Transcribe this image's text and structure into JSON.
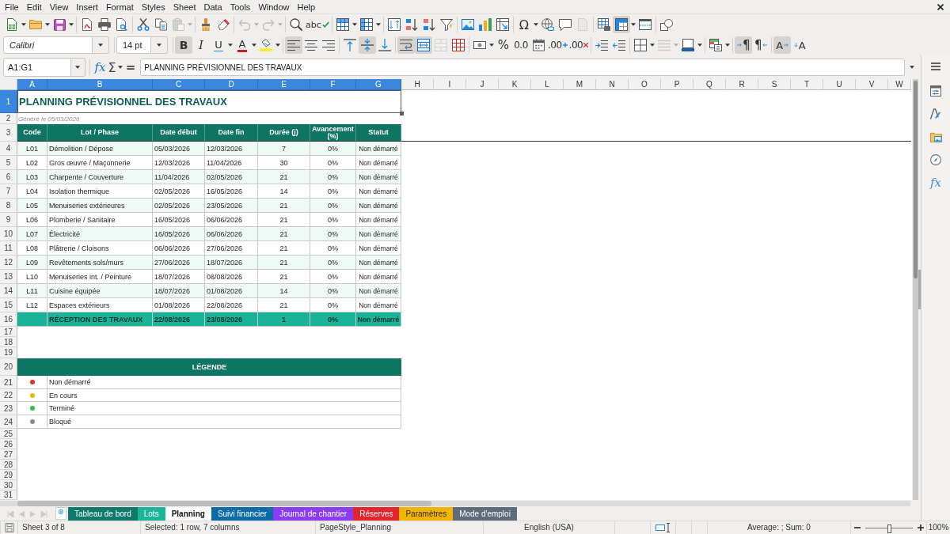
{
  "menu": [
    "File",
    "Edit",
    "View",
    "Insert",
    "Format",
    "Styles",
    "Sheet",
    "Data",
    "Tools",
    "Window",
    "Help"
  ],
  "standard_toolbar": [
    [
      {
        "kind": "new",
        "dropdown": true,
        "on": false,
        "disabled": false
      },
      {
        "kind": "open",
        "dropdown": true,
        "on": false,
        "disabled": false
      },
      {
        "kind": "save",
        "dropdown": true,
        "on": false,
        "disabled": false
      }
    ],
    [
      {
        "kind": "export_pdf",
        "dropdown": false,
        "on": false,
        "disabled": false
      },
      {
        "kind": "print",
        "dropdown": false,
        "on": false,
        "disabled": false
      },
      {
        "kind": "print_preview",
        "dropdown": false,
        "on": false,
        "disabled": false
      }
    ],
    [
      {
        "kind": "cut",
        "dropdown": false,
        "on": false,
        "disabled": false
      },
      {
        "kind": "copy",
        "dropdown": false,
        "on": false,
        "disabled": false
      },
      {
        "kind": "paste",
        "dropdown": true,
        "on": false,
        "disabled": true
      }
    ],
    [
      {
        "kind": "clone_formatting",
        "dropdown": false,
        "on": false,
        "disabled": false
      },
      {
        "kind": "clear_formatting",
        "dropdown": false,
        "on": false,
        "disabled": false
      }
    ],
    [
      {
        "kind": "undo",
        "dropdown": true,
        "on": false,
        "disabled": true
      },
      {
        "kind": "redo",
        "dropdown": true,
        "on": false,
        "disabled": true
      }
    ],
    [
      {
        "kind": "find_replace",
        "dropdown": false,
        "on": false,
        "disabled": false
      },
      {
        "kind": "spelling",
        "label": "abc",
        "dropdown": false,
        "on": false,
        "disabled": false
      }
    ],
    [
      {
        "kind": "row",
        "dropdown": true,
        "on": false,
        "disabled": false
      },
      {
        "kind": "column",
        "dropdown": true,
        "on": false,
        "disabled": false
      }
    ],
    [
      {
        "kind": "sort",
        "dropdown": false,
        "on": false,
        "disabled": false
      },
      {
        "kind": "sort_ascending",
        "dropdown": false,
        "on": false,
        "disabled": false
      },
      {
        "kind": "sort_descending",
        "dropdown": false,
        "on": false,
        "disabled": false
      },
      {
        "kind": "autofilter",
        "dropdown": false,
        "on": false,
        "disabled": false
      }
    ],
    [
      {
        "kind": "image",
        "dropdown": false,
        "on": false,
        "disabled": false
      },
      {
        "kind": "chart",
        "dropdown": false,
        "on": false,
        "disabled": false
      },
      {
        "kind": "pivot_table",
        "dropdown": false,
        "on": false,
        "disabled": false
      }
    ],
    [
      {
        "kind": "special_character",
        "label": "Ω",
        "dropdown": true,
        "on": false,
        "disabled": false
      },
      {
        "kind": "hyperlink",
        "dropdown": false,
        "on": false,
        "disabled": false
      },
      {
        "kind": "comment",
        "dropdown": false,
        "on": false,
        "disabled": false
      },
      {
        "kind": "header_footer",
        "dropdown": false,
        "on": false,
        "disabled": true
      }
    ],
    [
      {
        "kind": "print_area",
        "dropdown": false,
        "on": false,
        "disabled": false
      },
      {
        "kind": "freeze",
        "dropdown": true,
        "on": true,
        "disabled": false
      },
      {
        "kind": "split_window",
        "dropdown": false,
        "on": false,
        "disabled": false
      }
    ],
    [
      {
        "kind": "shapes",
        "dropdown": false,
        "on": false,
        "disabled": false
      }
    ]
  ],
  "formatting_toolbar": [
    [
      {
        "kind": "font_name",
        "value": "Calibri",
        "dropdown": true
      }
    ],
    [
      {
        "kind": "font_size",
        "value": "14 pt",
        "dropdown": true
      }
    ],
    [
      {
        "kind": "bold",
        "label": "B",
        "dropdown": false,
        "on": true,
        "disabled": false
      },
      {
        "kind": "italic",
        "label": "I",
        "dropdown": false,
        "on": false,
        "disabled": false
      },
      {
        "kind": "underline",
        "label": "U",
        "dropdown": true,
        "on": false,
        "disabled": false
      },
      {
        "kind": "font_color",
        "label": "A",
        "dropdown": true,
        "on": false,
        "disabled": false
      },
      {
        "kind": "highlight",
        "dropdown": true,
        "on": false,
        "disabled": false
      }
    ],
    [
      {
        "kind": "align_left",
        "dropdown": false,
        "on": true,
        "disabled": false
      },
      {
        "kind": "align_center",
        "dropdown": false,
        "on": false,
        "disabled": false
      },
      {
        "kind": "align_right",
        "dropdown": false,
        "on": false,
        "disabled": false
      }
    ],
    [
      {
        "kind": "align_top",
        "dropdown": false,
        "on": false,
        "disabled": false
      },
      {
        "kind": "align_middle",
        "dropdown": false,
        "on": true,
        "disabled": false
      },
      {
        "kind": "align_bottom",
        "dropdown": false,
        "on": false,
        "disabled": false
      }
    ],
    [
      {
        "kind": "wrap_text",
        "dropdown": false,
        "on": true,
        "disabled": false
      },
      {
        "kind": "merge_center",
        "dropdown": false,
        "on": true,
        "disabled": false
      },
      {
        "kind": "merge_cells",
        "dropdown": false,
        "on": false,
        "disabled": true
      },
      {
        "kind": "unmerge_cells",
        "dropdown": false,
        "on": false,
        "disabled": false
      }
    ],
    [
      {
        "kind": "number_format",
        "dropdown": true,
        "on": false,
        "disabled": false
      },
      {
        "kind": "percent",
        "label": "%",
        "dropdown": false,
        "on": false,
        "disabled": false
      },
      {
        "kind": "number",
        "label": "0.0",
        "dropdown": false,
        "on": false,
        "disabled": false
      },
      {
        "kind": "date",
        "dropdown": false,
        "on": false,
        "disabled": false
      },
      {
        "kind": "add_decimal",
        "label": ".00",
        "dropdown": false,
        "on": false,
        "disabled": false
      },
      {
        "kind": "delete_decimal",
        "label": ".00",
        "dropdown": false,
        "on": false,
        "disabled": false
      }
    ],
    [
      {
        "kind": "indent",
        "dropdown": false,
        "on": false,
        "disabled": false
      },
      {
        "kind": "outdent",
        "dropdown": false,
        "on": false,
        "disabled": false
      }
    ],
    [
      {
        "kind": "borders",
        "dropdown": true,
        "on": false,
        "disabled": false
      },
      {
        "kind": "border_style",
        "dropdown": true,
        "on": false,
        "disabled": true
      },
      {
        "kind": "border_color",
        "dropdown": true,
        "on": false,
        "disabled": false
      }
    ],
    [
      {
        "kind": "conditional",
        "dropdown": true,
        "on": false,
        "disabled": false
      }
    ],
    [
      {
        "kind": "left_to_right",
        "label": "¶",
        "dropdown": false,
        "on": true,
        "disabled": false
      },
      {
        "kind": "right_to_left",
        "label": "¶",
        "dropdown": false,
        "on": false,
        "disabled": false
      }
    ],
    [
      {
        "kind": "text_left_to_right",
        "label": "A",
        "dropdown": false,
        "on": true,
        "disabled": false
      },
      {
        "kind": "text_top_to_bottom",
        "label": "A",
        "dropdown": false,
        "on": false,
        "disabled": false
      }
    ]
  ],
  "formula_bar": {
    "name_box": "A1:G1",
    "function_wizard": "fx",
    "sum": "Σ",
    "equals": "=",
    "formula": "PLANNING PRÉVISIONNEL DES TRAVAUX"
  },
  "sheet": {
    "columns": [
      {
        "label": "A",
        "selected": true
      },
      {
        "label": "B",
        "selected": true
      },
      {
        "label": "C",
        "selected": true
      },
      {
        "label": "D",
        "selected": true
      },
      {
        "label": "E",
        "selected": true
      },
      {
        "label": "F",
        "selected": true
      },
      {
        "label": "G",
        "selected": true
      },
      {
        "label": "H",
        "selected": false
      },
      {
        "label": "I",
        "selected": false
      },
      {
        "label": "J",
        "selected": false
      },
      {
        "label": "K",
        "selected": false
      },
      {
        "label": "L",
        "selected": false
      },
      {
        "label": "M",
        "selected": false
      },
      {
        "label": "N",
        "selected": false
      },
      {
        "label": "O",
        "selected": false
      },
      {
        "label": "P",
        "selected": false
      },
      {
        "label": "Q",
        "selected": false
      },
      {
        "label": "R",
        "selected": false
      },
      {
        "label": "S",
        "selected": false
      },
      {
        "label": "T",
        "selected": false
      },
      {
        "label": "U",
        "selected": false
      },
      {
        "label": "V",
        "selected": false
      },
      {
        "label": "W",
        "selected": false
      }
    ],
    "rows": [
      {
        "label": "1",
        "selected": true
      },
      {
        "label": "2",
        "selected": false
      },
      {
        "label": "3",
        "selected": false
      },
      {
        "label": "4",
        "selected": false
      },
      {
        "label": "5",
        "selected": false
      },
      {
        "label": "6",
        "selected": false
      },
      {
        "label": "7",
        "selected": false
      },
      {
        "label": "8",
        "selected": false
      },
      {
        "label": "9",
        "selected": false
      },
      {
        "label": "10",
        "selected": false
      },
      {
        "label": "11",
        "selected": false
      },
      {
        "label": "12",
        "selected": false
      },
      {
        "label": "13",
        "selected": false
      },
      {
        "label": "14",
        "selected": false
      },
      {
        "label": "15",
        "selected": false
      },
      {
        "label": "16",
        "selected": false
      },
      {
        "label": "17",
        "selected": false
      },
      {
        "label": "18",
        "selected": false
      },
      {
        "label": "19",
        "selected": false
      },
      {
        "label": "20",
        "selected": false
      },
      {
        "label": "21",
        "selected": false
      },
      {
        "label": "22",
        "selected": false
      },
      {
        "label": "23",
        "selected": false
      },
      {
        "label": "24",
        "selected": false
      },
      {
        "label": "25",
        "selected": false
      },
      {
        "label": "26",
        "selected": false
      },
      {
        "label": "27",
        "selected": false
      },
      {
        "label": "28",
        "selected": false
      },
      {
        "label": "29",
        "selected": false
      },
      {
        "label": "30",
        "selected": false
      },
      {
        "label": "31",
        "selected": false
      }
    ],
    "title": "PLANNING PRÉVISIONNEL DES TRAVAUX",
    "subtitle": "Généré le 05/03/2026",
    "table": {
      "columns": [
        "Code",
        "Lot / Phase",
        "Date début",
        "Date fin",
        "Durée (j)",
        "Avancement (%)",
        "Statut"
      ],
      "rows": [
        {
          "kind": "task",
          "code": "L01",
          "lot": "Démolition / Dépose",
          "start": "05/03/2026",
          "end": "12/03/2026",
          "duration": "7",
          "progress": "0%",
          "status": "Non démarré"
        },
        {
          "kind": "task",
          "code": "L02",
          "lot": "Gros œuvre / Maçonnerie",
          "start": "12/03/2026",
          "end": "11/04/2026",
          "duration": "30",
          "progress": "0%",
          "status": "Non démarré"
        },
        {
          "kind": "task",
          "code": "L03",
          "lot": "Charpente / Couverture",
          "start": "11/04/2026",
          "end": "02/05/2026",
          "duration": "21",
          "progress": "0%",
          "status": "Non démarré"
        },
        {
          "kind": "task",
          "code": "L04",
          "lot": "Isolation thermique",
          "start": "02/05/2026",
          "end": "16/05/2026",
          "duration": "14",
          "progress": "0%",
          "status": "Non démarré"
        },
        {
          "kind": "task",
          "code": "L05",
          "lot": "Menuiseries extérieures",
          "start": "02/05/2026",
          "end": "23/05/2026",
          "duration": "21",
          "progress": "0%",
          "status": "Non démarré"
        },
        {
          "kind": "task",
          "code": "L06",
          "lot": "Plomberie / Sanitaire",
          "start": "16/05/2026",
          "end": "06/06/2026",
          "duration": "21",
          "progress": "0%",
          "status": "Non démarré"
        },
        {
          "kind": "task",
          "code": "L07",
          "lot": "Électricité",
          "start": "16/05/2026",
          "end": "06/06/2026",
          "duration": "21",
          "progress": "0%",
          "status": "Non démarré"
        },
        {
          "kind": "task",
          "code": "L08",
          "lot": "Plâtrerie / Cloisons",
          "start": "06/06/2026",
          "end": "27/06/2026",
          "duration": "21",
          "progress": "0%",
          "status": "Non démarré"
        },
        {
          "kind": "task",
          "code": "L09",
          "lot": "Revêtements sols/murs",
          "start": "27/06/2026",
          "end": "18/07/2026",
          "duration": "21",
          "progress": "0%",
          "status": "Non démarré"
        },
        {
          "kind": "task",
          "code": "L10",
          "lot": "Menuiseries int. / Peinture",
          "start": "18/07/2026",
          "end": "08/08/2026",
          "duration": "21",
          "progress": "0%",
          "status": "Non démarré"
        },
        {
          "kind": "task",
          "code": "L11",
          "lot": "Cuisine équipée",
          "start": "18/07/2026",
          "end": "01/08/2026",
          "duration": "14",
          "progress": "0%",
          "status": "Non démarré"
        },
        {
          "kind": "task",
          "code": "L12",
          "lot": "Espaces extérieurs",
          "start": "01/08/2026",
          "end": "22/08/2026",
          "duration": "21",
          "progress": "0%",
          "status": "Non démarré"
        },
        {
          "kind": "milestone",
          "lot": "RÉCEPTION DES TRAVAUX",
          "start": "22/08/2026",
          "end": "23/08/2026",
          "duration": "1",
          "progress": "0%",
          "status": "Non démarré"
        }
      ]
    },
    "legend": {
      "title": "LÉGENDE",
      "items": [
        {
          "label": "Non démarré",
          "color": "#e03131"
        },
        {
          "label": "En cours",
          "color": "#f0b400"
        },
        {
          "label": "Terminé",
          "color": "#2fbf4f"
        },
        {
          "label": "Bloqué",
          "color": "#8a8a8a"
        }
      ]
    }
  },
  "sidebar": {
    "items": [
      {
        "kind": "properties"
      },
      {
        "kind": "styles"
      },
      {
        "kind": "gallery"
      },
      {
        "kind": "navigator"
      },
      {
        "kind": "functions",
        "label": "fx"
      }
    ]
  },
  "sheet_tabs": [
    {
      "label": "Tableau de bord",
      "color": "#0f7a6c",
      "selected": false
    },
    {
      "label": "Lots",
      "color": "#1bb59c",
      "selected": false
    },
    {
      "label": "Planning",
      "selected": true
    },
    {
      "label": "Suivi financier",
      "color": "#0b6aa8",
      "selected": false
    },
    {
      "label": "Journal de chantier",
      "color": "#8b3cf7",
      "selected": false
    },
    {
      "label": "Réserves",
      "color": "#e3262d",
      "selected": false
    },
    {
      "label": "Paramètres",
      "color": "#f2b400",
      "selected": false
    },
    {
      "label": "Mode d'emploi",
      "color": "#5f6b7b",
      "selected": false
    }
  ],
  "status_bar": {
    "sheet": "Sheet 3 of 8",
    "selection": "Selected: 1 row, 7 columns",
    "page_style": "PageStyle_Planning",
    "language": "English (USA)",
    "summary": "Average: ; Sum: 0",
    "zoom_slider": {
      "level": 0.5
    },
    "zoom": "100%"
  }
}
